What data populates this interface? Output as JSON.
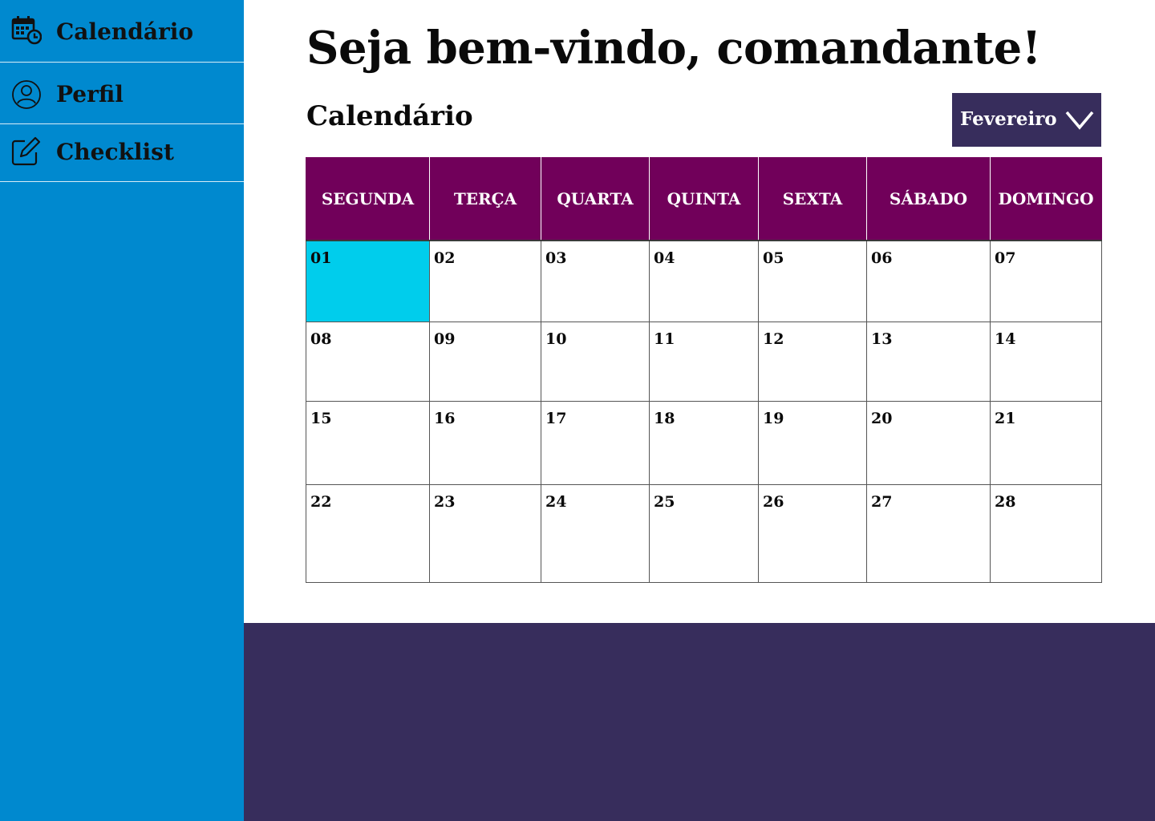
{
  "sidebar": {
    "items": [
      {
        "label": "Calendário",
        "icon": "calendar-clock-icon"
      },
      {
        "label": "Perfil",
        "icon": "user-circle-icon"
      },
      {
        "label": "Checklist",
        "icon": "edit-icon"
      }
    ]
  },
  "main": {
    "title": "Seja bem-vindo, comandante!",
    "section_title": "Calendário",
    "month_select": {
      "value": "Fevereiro",
      "icon": "chevron-down-icon"
    }
  },
  "calendar": {
    "weekdays": [
      "SEGUNDA",
      "TERÇA",
      "QUARTA",
      "QUINTA",
      "SEXTA",
      "SÁBADO",
      "DOMINGO"
    ],
    "weeks": [
      [
        "01",
        "02",
        "03",
        "04",
        "05",
        "06",
        "07"
      ],
      [
        "08",
        "09",
        "10",
        "11",
        "12",
        "13",
        "14"
      ],
      [
        "15",
        "16",
        "17",
        "18",
        "19",
        "20",
        "21"
      ],
      [
        "22",
        "23",
        "24",
        "25",
        "26",
        "27",
        "28"
      ]
    ],
    "selected_day": "01"
  },
  "colors": {
    "sidebar": "#0089CF",
    "header": "#71005A",
    "accent_dark": "#372D5C",
    "selected_day": "#00CDEC"
  }
}
